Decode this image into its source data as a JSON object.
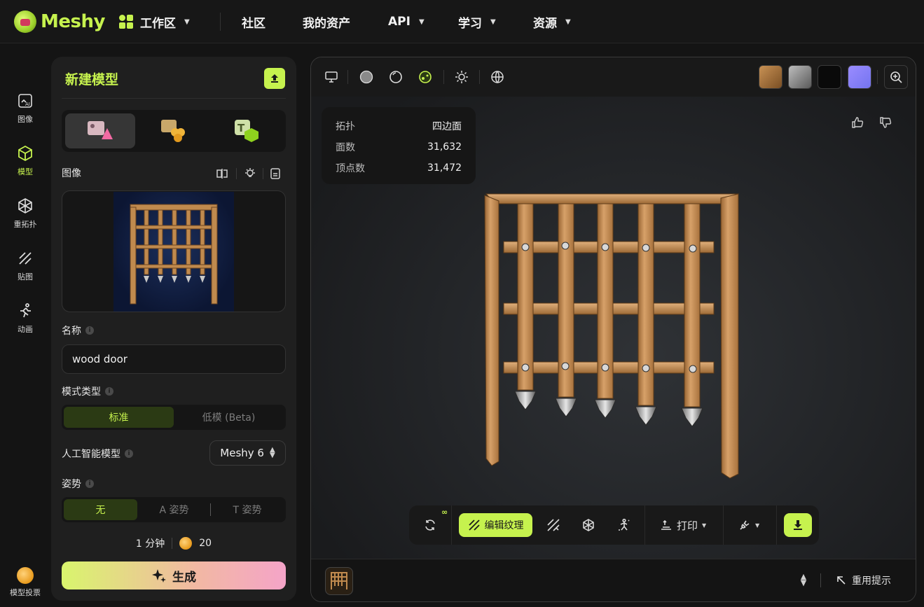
{
  "app": {
    "name": "Meshy",
    "accent": "#c6f24e"
  },
  "nav": {
    "items": [
      {
        "label": "工作区",
        "has_caret": true
      },
      {
        "label": "社区"
      },
      {
        "label": "我的资产"
      },
      {
        "label": "API",
        "has_caret": true
      },
      {
        "label": "学习",
        "has_caret": true
      },
      {
        "label": "资源",
        "has_caret": true
      }
    ]
  },
  "rail": {
    "items": [
      {
        "label": "图像",
        "icon": "ai-image-icon"
      },
      {
        "label": "模型",
        "icon": "cube-icon",
        "active": true
      },
      {
        "label": "重拓扑",
        "icon": "retopology-icon"
      },
      {
        "label": "贴图",
        "icon": "texture-icon"
      },
      {
        "label": "动画",
        "icon": "running-figure-icon"
      }
    ],
    "vote_label": "模型投票"
  },
  "panel": {
    "title": "新建模型",
    "image_label": "图像",
    "name_label": "名称",
    "name_value": "wood door",
    "mode_type_label": "模式类型",
    "mode_type_options": [
      "标准",
      "低模 (Beta)"
    ],
    "mode_type_selected": "标准",
    "ai_model_label": "人工智能模型",
    "ai_model_value": "Meshy 6",
    "pose_label": "姿势",
    "pose_options": [
      "无",
      "A 姿势",
      "T 姿势"
    ],
    "pose_selected": "无",
    "time": "1 分钟",
    "credits": "20",
    "generate_label": "生成"
  },
  "viewer": {
    "stats": [
      {
        "key": "拓扑",
        "value": "四边面"
      },
      {
        "key": "面数",
        "value": "31,632"
      },
      {
        "key": "顶点数",
        "value": "31,472"
      }
    ],
    "bottom": {
      "edit_texture_label": "编辑纹理",
      "edit_texture_badge": "∞",
      "print_label": "打印"
    },
    "footer": {
      "reuse_label": "重用提示"
    }
  }
}
